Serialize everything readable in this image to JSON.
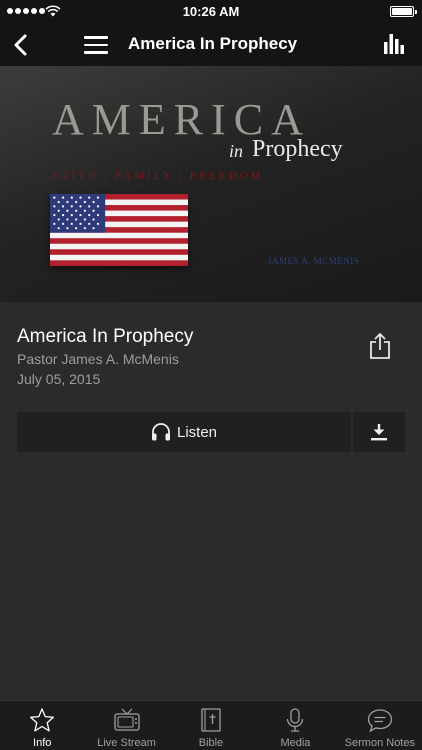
{
  "status_bar": {
    "time": "10:26 AM"
  },
  "nav": {
    "title": "America In Prophecy"
  },
  "banner": {
    "heading": "AMERICA",
    "in": "in",
    "prophecy": "Prophecy",
    "tagline": "FAITH | FAMILY | FREEDOM",
    "author": "JAMES A. MCMENIS"
  },
  "sermon": {
    "title": "America In Prophecy",
    "speaker": "Pastor James A. McMenis",
    "date": "July 05, 2015"
  },
  "actions": {
    "listen_label": "Listen"
  },
  "tabs": [
    {
      "label": "Info",
      "icon": "star-icon",
      "active": true
    },
    {
      "label": "Live Stream",
      "icon": "tv-icon",
      "active": false
    },
    {
      "label": "Bible",
      "icon": "bible-icon",
      "active": false
    },
    {
      "label": "Media",
      "icon": "microphone-icon",
      "active": false
    },
    {
      "label": "Sermon Notes",
      "icon": "speech-bubble-icon",
      "active": false
    }
  ],
  "colors": {
    "background": "#2b2b2b",
    "bar": "#141414",
    "secondary_text": "#9e9e9e",
    "tagline": "#7a1818"
  }
}
